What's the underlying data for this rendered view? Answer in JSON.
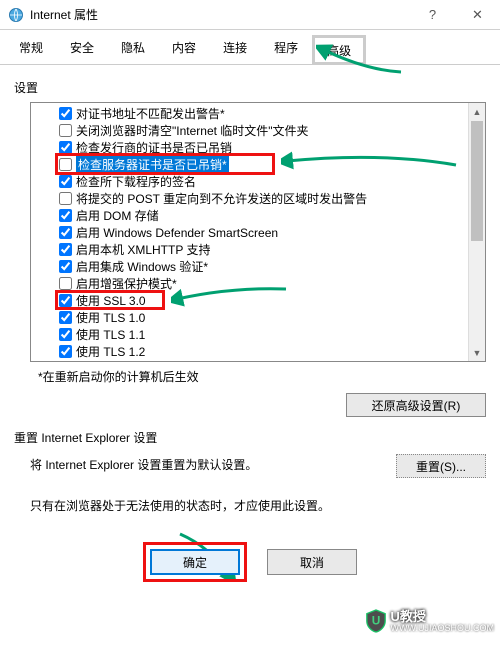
{
  "window": {
    "title": "Internet 属性",
    "help": "?",
    "close": "✕"
  },
  "tabs": [
    "常规",
    "安全",
    "隐私",
    "内容",
    "连接",
    "程序",
    "高级"
  ],
  "active_tab": 6,
  "section": {
    "label": "设置"
  },
  "settings": [
    {
      "checked": true,
      "label": "对证书地址不匹配发出警告*"
    },
    {
      "checked": false,
      "label": "关闭浏览器时清空\"Internet 临时文件\"文件夹"
    },
    {
      "checked": true,
      "label": "检查发行商的证书是否已吊销"
    },
    {
      "checked": false,
      "label": "检查服务器证书是否已吊销*",
      "selected": true
    },
    {
      "checked": true,
      "label": "检查所下载程序的签名"
    },
    {
      "checked": false,
      "label": "将提交的 POST 重定向到不允许发送的区域时发出警告"
    },
    {
      "checked": true,
      "label": "启用 DOM 存储"
    },
    {
      "checked": true,
      "label": "启用 Windows Defender SmartScreen"
    },
    {
      "checked": true,
      "label": "启用本机 XMLHTTP 支持"
    },
    {
      "checked": true,
      "label": "启用集成 Windows 验证*"
    },
    {
      "checked": false,
      "label": "启用增强保护模式*"
    },
    {
      "checked": true,
      "label": "使用 SSL 3.0"
    },
    {
      "checked": true,
      "label": "使用 TLS 1.0"
    },
    {
      "checked": true,
      "label": "使用 TLS 1.1"
    },
    {
      "checked": true,
      "label": "使用 TLS 1.2"
    }
  ],
  "restart_note": "*在重新启动你的计算机后生效",
  "restore_btn": "还原高级设置(R)",
  "reset_group": "重置 Internet Explorer 设置",
  "reset_desc": "将 Internet Explorer 设置重置为默认设置。",
  "reset_btn": "重置(S)...",
  "reset_warn": "只有在浏览器处于无法使用的状态时，才应使用此设置。",
  "ok_btn": "确定",
  "cancel_btn": "取消",
  "watermark": {
    "name": "U教授",
    "url": "WWW.UJIAOSHOU.COM"
  }
}
